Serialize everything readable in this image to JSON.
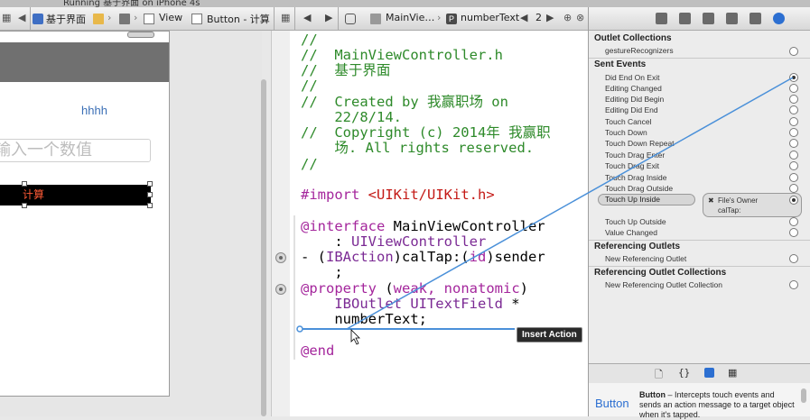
{
  "title_bar": {
    "running_text": "Running 基于界面 on iPhone 4s"
  },
  "jump_bar": {
    "project": "基于界面",
    "view_item": "View",
    "button_item": "Button - 计算",
    "file": "MainVie…",
    "symbol": "numberText",
    "counterpart_index": "2"
  },
  "canvas": {
    "label_text": "hhhh",
    "textfield_placeholder": "输入一个数值",
    "button_title": "计算"
  },
  "code_lines": [
    "//",
    "//  MainViewController.h",
    "//  基于界面",
    "//",
    "//  Created by 我赢职场 on",
    "    22/8/14.",
    "//  Copyright (c) 2014年 我赢职",
    "    场. All rights reserved.",
    "//"
  ],
  "code": {
    "import_kw": "#import",
    "import_path": "<UIKit/UIKit.h>",
    "interface_kw": "@interface",
    "interface_name": " MainViewController",
    "superclass_colon": "    : ",
    "superclass": "UIViewController",
    "action_prefix": "- (",
    "action_ret": "IBAction",
    "action_mid": ")calTap:(",
    "action_arg": "id",
    "action_end": ")sender",
    "action_semicolon": "    ;",
    "property_kw": "@property",
    "property_open": " (",
    "property_attrs": "weak, nonatomic",
    "property_close": ")",
    "outlet_indent": "    ",
    "outlet_kw": "IBOutlet",
    "outlet_type": " UITextField",
    "outlet_star": " *",
    "outlet_name": "    numberText;",
    "end_kw": "@end"
  },
  "tooltip": "Insert Action",
  "inspector": {
    "sections": {
      "outlet_collections": "Outlet Collections",
      "sent_events": "Sent Events",
      "referencing_outlets": "Referencing Outlets",
      "referencing_outlet_collections": "Referencing Outlet Collections"
    },
    "gesture": "gestureRecognizers",
    "events": [
      "Did End On Exit",
      "Editing Changed",
      "Editing Did Begin",
      "Editing Did End",
      "Touch Cancel",
      "Touch Down",
      "Touch Down Repeat",
      "Touch Drag Enter",
      "Touch Drag Exit",
      "Touch Drag Inside",
      "Touch Drag Outside",
      "Touch Up Inside",
      "Touch Up Outside",
      "Value Changed"
    ],
    "connection": {
      "target": "File's Owner",
      "action": "calTap:"
    },
    "new_referencing_outlet": "New Referencing Outlet",
    "new_referencing_outlet_collection": "New Referencing Outlet Collection",
    "library_tabs": [
      "file-icon",
      "braces-icon",
      "cube-icon",
      "media-icon"
    ],
    "library_item": {
      "icon_label": "Button",
      "name": "Button",
      "description": " – Intercepts touch events and sends an action message to a target object when it's tapped."
    }
  },
  "colors": {
    "comment": "#2e8a2a",
    "keyword": "#a4269c",
    "string": "#c41a16",
    "connection_line": "#4a90d9"
  }
}
